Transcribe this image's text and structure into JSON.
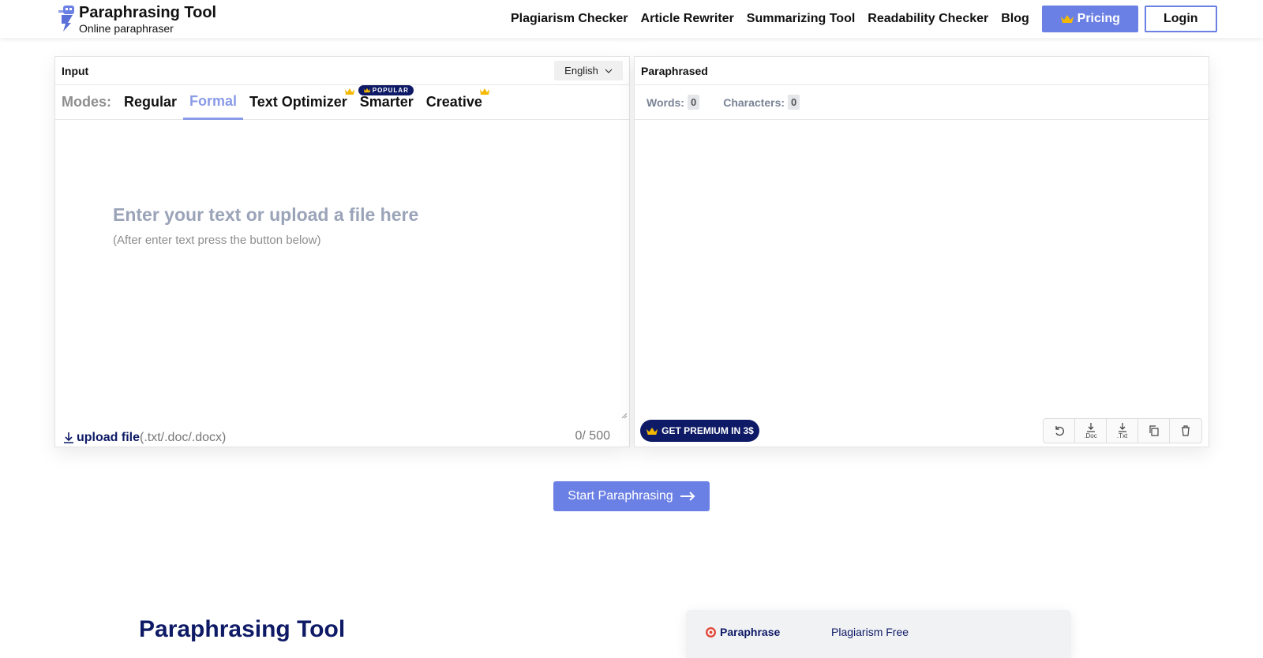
{
  "header": {
    "title": "Paraphrasing Tool",
    "subtitle": "Online paraphraser",
    "nav": [
      "Plagiarism Checker",
      "Article Rewriter",
      "Summarizing Tool",
      "Readability Checker",
      "Blog"
    ],
    "pricing_label": "Pricing",
    "login_label": "Login",
    "accent_color": "#6b80e4"
  },
  "input_panel": {
    "title": "Input",
    "language": "English",
    "modes_label": "Modes:",
    "modes": [
      "Regular",
      "Formal",
      "Text Optimizer",
      "Smarter",
      "Creative"
    ],
    "active_mode": "Formal",
    "popular_badge": "POPULAR",
    "placeholder_main": "Enter your text or upload a file here",
    "placeholder_sub": "(After enter text press the button below)",
    "upload_label": "upload file",
    "upload_ext": "(.txt/.doc/.docx)",
    "counter": "0/ 500"
  },
  "output_panel": {
    "title": "Paraphrased",
    "words_label": "Words:",
    "words_value": "0",
    "chars_label": "Characters:",
    "chars_value": "0",
    "premium_label": "GET PREMIUM IN 3$",
    "tools": {
      "doc": ".Doc",
      "txt": ".Txt"
    }
  },
  "start_label": "Start Paraphrasing",
  "bottom": {
    "title": "Paraphrasing Tool",
    "tab1": "Paraphrase",
    "tab2": "Plagiarism Free"
  }
}
